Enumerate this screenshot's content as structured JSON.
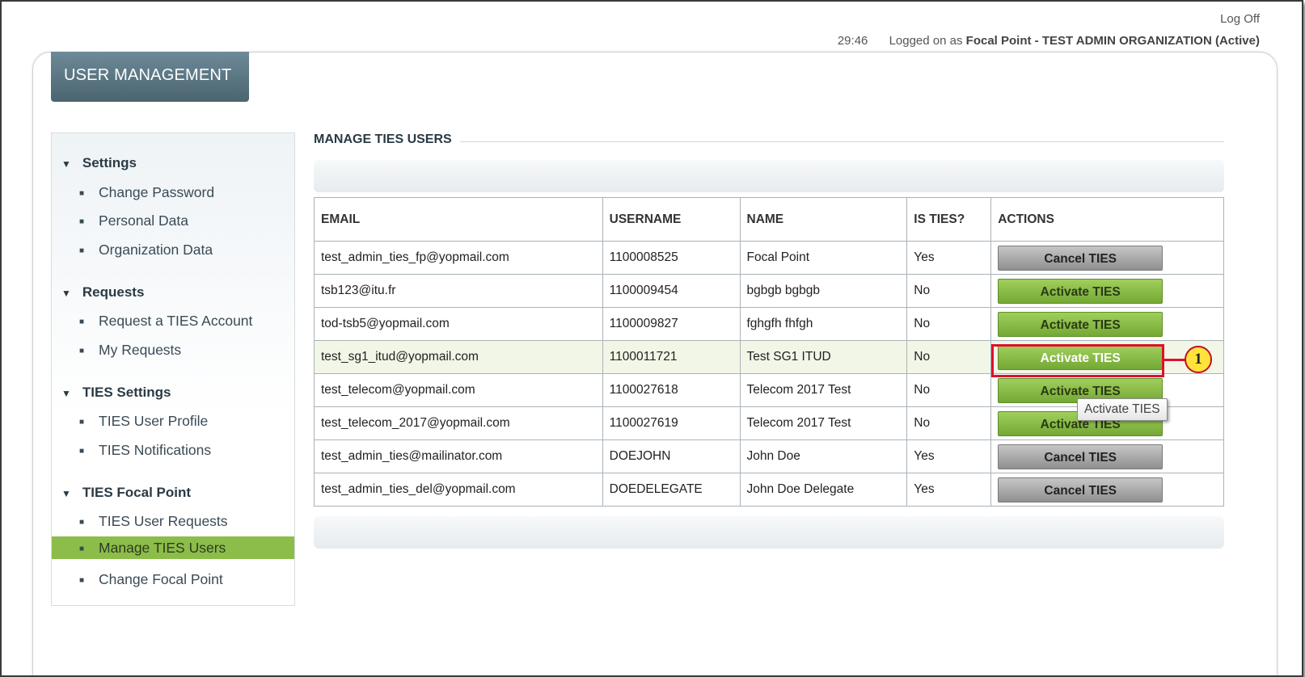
{
  "header": {
    "logoff": "Log Off",
    "timer": "29:46",
    "logged_prefix": "Logged on as",
    "logged_user": "Focal Point - TEST ADMIN ORGANIZATION (Active)"
  },
  "tab": {
    "label": "USER MANAGEMENT"
  },
  "sidebar": {
    "sections": [
      {
        "title": "Settings",
        "items": [
          "Change Password",
          "Personal Data",
          "Organization Data"
        ]
      },
      {
        "title": "Requests",
        "items": [
          "Request a TIES Account",
          "My Requests"
        ]
      },
      {
        "title": "TIES Settings",
        "items": [
          "TIES User Profile",
          "TIES Notifications"
        ]
      },
      {
        "title": "TIES Focal Point",
        "items": [
          "TIES User Requests",
          "Manage TIES Users",
          "Change Focal Point"
        ]
      }
    ],
    "active_item": "Manage TIES Users"
  },
  "main": {
    "title": "MANAGE TIES USERS",
    "columns": [
      "EMAIL",
      "USERNAME",
      "NAME",
      "IS TIES?",
      "ACTIONS"
    ],
    "rows": [
      {
        "email": "test_admin_ties_fp@yopmail.com",
        "username": "1100008525",
        "name": "Focal Point",
        "is_ties": "Yes",
        "action": "Cancel TIES"
      },
      {
        "email": "tsb123@itu.fr",
        "username": "1100009454",
        "name": "bgbgb bgbgb",
        "is_ties": "No",
        "action": "Activate TIES"
      },
      {
        "email": "tod-tsb5@yopmail.com",
        "username": "1100009827",
        "name": "fghgfh fhfgh",
        "is_ties": "No",
        "action": "Activate TIES"
      },
      {
        "email": "test_sg1_itud@yopmail.com",
        "username": "1100011721",
        "name": "Test SG1 ITUD",
        "is_ties": "No",
        "action": "Activate TIES"
      },
      {
        "email": "test_telecom@yopmail.com",
        "username": "1100027618",
        "name": "Telecom 2017 Test",
        "is_ties": "No",
        "action": "Activate TIES"
      },
      {
        "email": "test_telecom_2017@yopmail.com",
        "username": "1100027619",
        "name": "Telecom 2017 Test",
        "is_ties": "No",
        "action": "Activate TIES"
      },
      {
        "email": "test_admin_ties@mailinator.com",
        "username": "DOEJOHN",
        "name": "John Doe",
        "is_ties": "Yes",
        "action": "Cancel TIES"
      },
      {
        "email": "test_admin_ties_del@yopmail.com",
        "username": "DOEDELEGATE",
        "name": "John Doe Delegate",
        "is_ties": "Yes",
        "action": "Cancel TIES"
      }
    ]
  },
  "annotation": {
    "callout_number": "1",
    "tooltip": "Activate TIES"
  },
  "colors": {
    "active_nav": "#8cbd4a",
    "callout_border": "#e0102a",
    "callout_fill": "#ffe33a"
  }
}
